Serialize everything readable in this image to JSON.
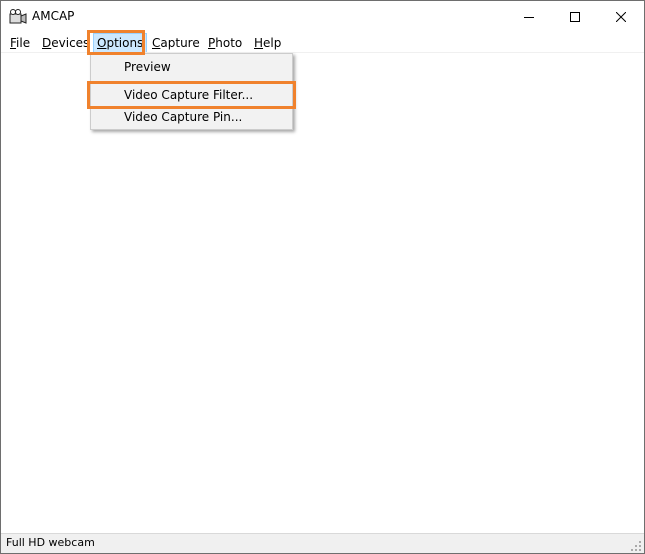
{
  "window": {
    "title": "AMCAP"
  },
  "menu": {
    "file": "File",
    "file_u": "F",
    "file_rest": "ile",
    "devices_u": "D",
    "devices_rest": "evices",
    "options_u": "O",
    "options_rest": "ptions",
    "capture_u": "C",
    "capture_rest": "apture",
    "photo_u": "P",
    "photo_rest": "hoto",
    "help_u": "H",
    "help_rest": "elp"
  },
  "options_menu": {
    "items": [
      "Preview",
      "Video Capture Filter...",
      "Video Capture Pin..."
    ]
  },
  "status": {
    "text": "Full HD webcam"
  },
  "colors": {
    "highlight": "#f0822d",
    "menu_selected": "#cce8ff"
  }
}
